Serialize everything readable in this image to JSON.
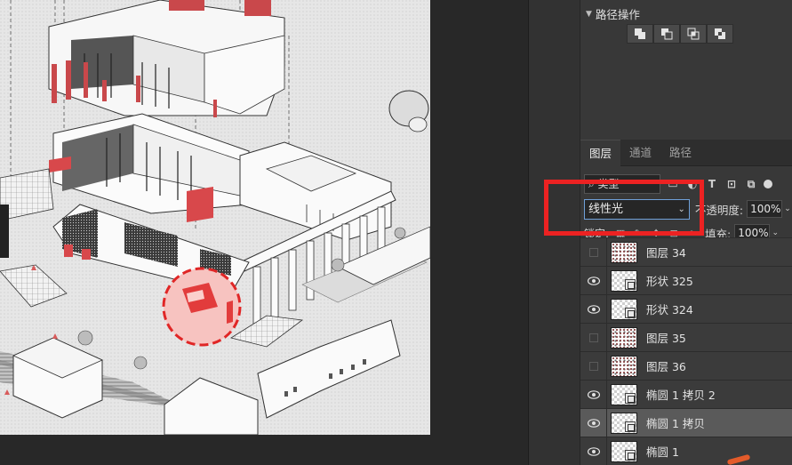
{
  "path_panel": {
    "title": "路径操作",
    "chevron_icon": "chevron-down-icon",
    "ops": [
      "combine-shapes-icon",
      "subtract-front-shape-icon",
      "intersect-shape-areas-icon",
      "exclude-overlapping-shapes-icon"
    ]
  },
  "layers_panel": {
    "tabs": [
      {
        "label": "图层",
        "active": true
      },
      {
        "label": "通道",
        "active": false
      },
      {
        "label": "路径",
        "active": false
      }
    ],
    "filter_kind": "类型",
    "filter_icons": [
      "pixel-filter-icon",
      "adjustment-filter-icon",
      "type-filter-icon",
      "shape-filter-icon",
      "smart-object-filter-icon"
    ],
    "filter_icon_glyphs": [
      "▭",
      "◐",
      "T",
      "⊡",
      "⧉"
    ],
    "blend_mode": "线性光",
    "opacity_label": "不透明度:",
    "opacity_value": "100%",
    "lock_label": "锁定:",
    "fill_label": "填充:",
    "fill_value": "100%",
    "layers": [
      {
        "name": "图层 34",
        "visible": false,
        "thumb": "noise",
        "shape": false,
        "selected": false
      },
      {
        "name": "形状 325",
        "visible": true,
        "thumb": "transparent",
        "shape": true,
        "selected": false
      },
      {
        "name": "形状 324",
        "visible": true,
        "thumb": "transparent",
        "shape": true,
        "selected": false
      },
      {
        "name": "图层 35",
        "visible": false,
        "thumb": "noise",
        "shape": false,
        "selected": false
      },
      {
        "name": "图层 36",
        "visible": false,
        "thumb": "noise",
        "shape": false,
        "selected": false
      },
      {
        "name": "椭圆 1 拷贝 2",
        "visible": true,
        "thumb": "transparent",
        "shape": true,
        "selected": false
      },
      {
        "name": "椭圆 1 拷贝",
        "visible": true,
        "thumb": "transparent",
        "shape": true,
        "selected": true
      },
      {
        "name": "椭圆 1",
        "visible": true,
        "thumb": "transparent",
        "shape": true,
        "selected": false
      }
    ]
  },
  "colors": {
    "highlight_red": "#ec2222",
    "accent_blue": "#6fa0d8",
    "panel_bg": "#383838"
  }
}
